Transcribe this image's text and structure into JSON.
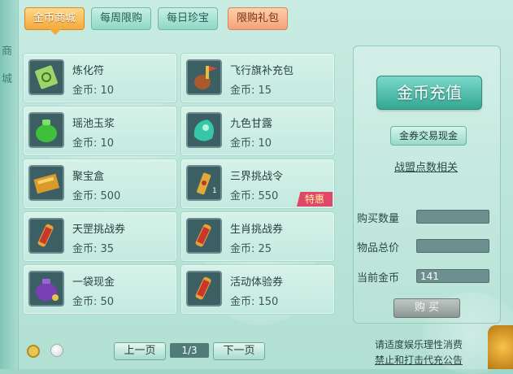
{
  "sidebar": {
    "text_1": "商",
    "text_2": "城"
  },
  "tabs": [
    {
      "label": "金币商城"
    },
    {
      "label": "每周限购"
    },
    {
      "label": "每日珍宝"
    },
    {
      "label": "限购礼包"
    }
  ],
  "items": [
    {
      "name": "炼化符",
      "price": "金币: 10"
    },
    {
      "name": "飞行旗补充包",
      "price": "金币: 15"
    },
    {
      "name": "瑶池玉浆",
      "price": "金币: 10"
    },
    {
      "name": "九色甘露",
      "price": "金币: 10"
    },
    {
      "name": "聚宝盒",
      "price": "金币: 500"
    },
    {
      "name": "三界挑战令",
      "price": "金币: 550",
      "badge": "特惠",
      "count": "1"
    },
    {
      "name": "天罡挑战券",
      "price": "金币: 35"
    },
    {
      "name": "生肖挑战券",
      "price": "金币: 25"
    },
    {
      "name": "一袋现金",
      "price": "金币: 50"
    },
    {
      "name": "活动体验券",
      "price": "金币: 150"
    }
  ],
  "right": {
    "recharge_label": "金币充值",
    "exchange_label": "金券交易现金",
    "alliance_link": "战盟点数相关",
    "qty_label": "购买数量",
    "total_label": "物品总价",
    "current_label": "当前金币",
    "qty_value": "",
    "total_value": "",
    "current_value": "141",
    "buy_label": "购 买"
  },
  "pager": {
    "prev": "上一页",
    "indicator": "1/3",
    "next": "下一页"
  },
  "notice": {
    "line1": "请适度娱乐理性消费",
    "line2": "禁止和打击代充公告"
  },
  "colors": {
    "accent_orange": "#f5a93a",
    "teal": "#34a893",
    "badge": "#e0486a"
  }
}
